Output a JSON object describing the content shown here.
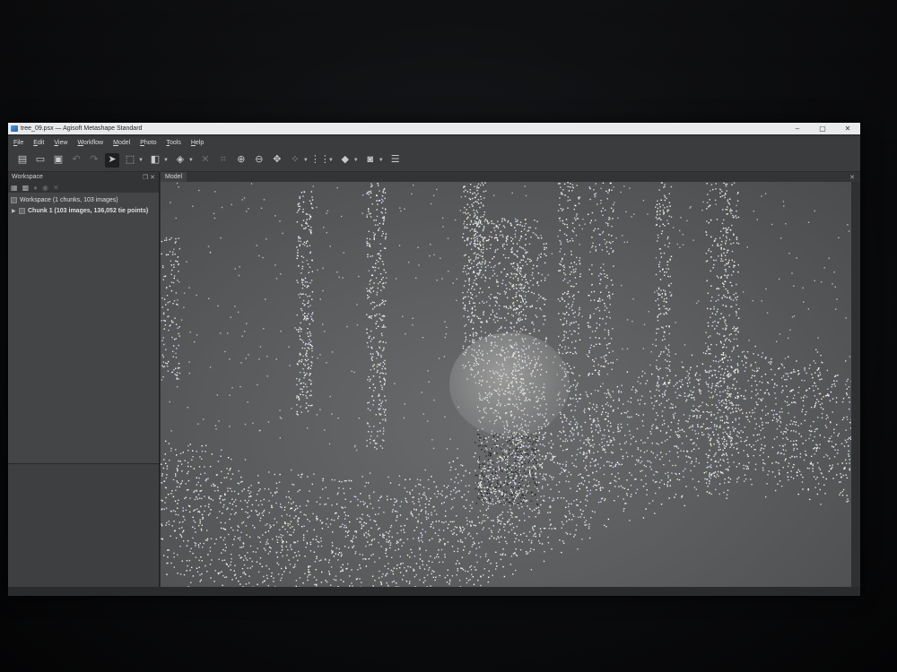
{
  "window": {
    "title": "tree_09.psx — Agisoft Metashape Standard",
    "controls": [
      "–",
      "▢",
      "✕"
    ]
  },
  "menu": [
    "File",
    "Edit",
    "View",
    "Workflow",
    "Model",
    "Photo",
    "Tools",
    "Help"
  ],
  "toolbar": {
    "icons": [
      "new-file-icon",
      "open-folder-icon",
      "save-icon",
      "undo-icon",
      "redo-icon",
      "select-arrow-icon",
      "rectangle-select-icon",
      "model-view-icon",
      "color-icon",
      "delete-icon",
      "crop-icon",
      "zoom-in-icon",
      "zoom-out-icon",
      "move-icon",
      "point-cloud-icon",
      "grid-icon",
      "shading-icon",
      "camera-icon",
      "stack-icon"
    ]
  },
  "workspace": {
    "panel_title": "Workspace",
    "root_label": "Workspace (1 chunks, 103 images)",
    "chunk_label": "Chunk 1 (103 images, 136,052 tie points)"
  },
  "model": {
    "tab_label": "Model"
  },
  "colors": {
    "background": "#2f3032",
    "panel": "#3c3d3f",
    "viewport": "#5b5c5e",
    "points": "#e8e8e8"
  }
}
